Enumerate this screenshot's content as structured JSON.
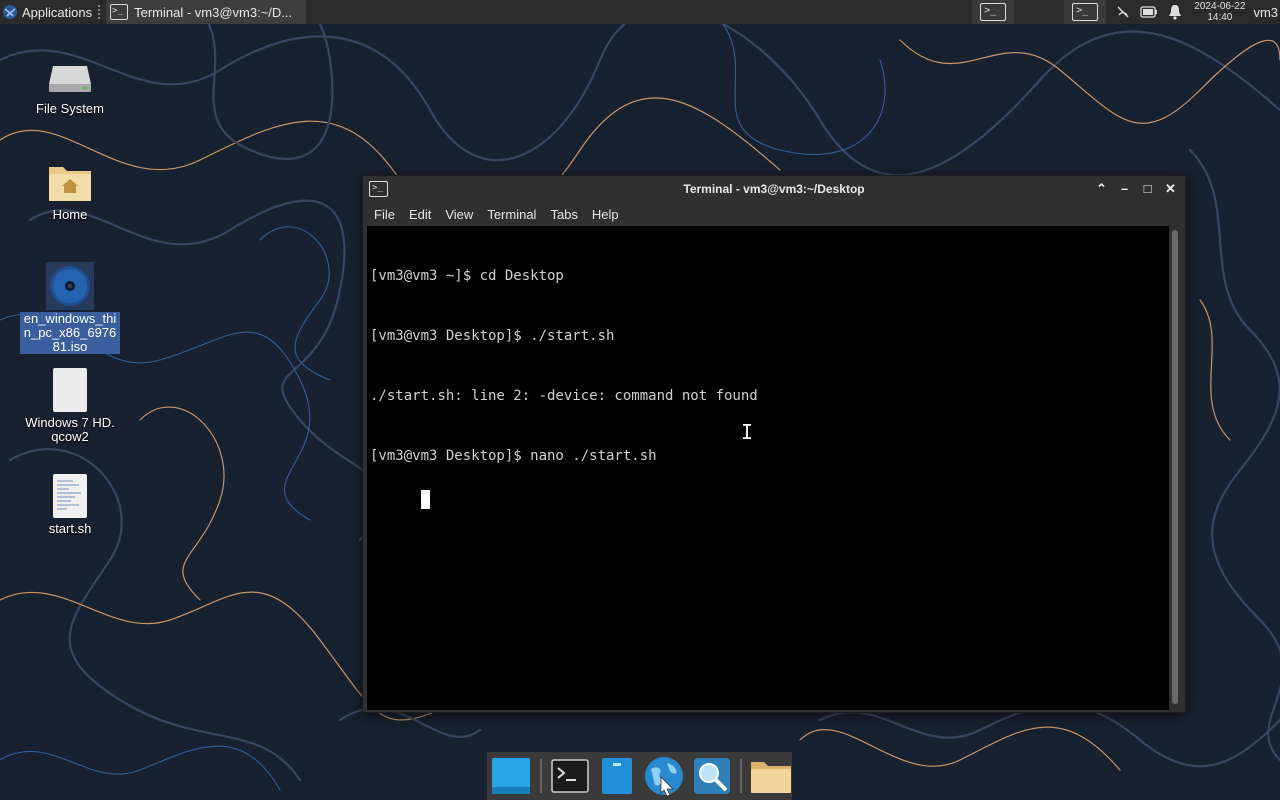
{
  "top_panel": {
    "applications_label": "Applications",
    "task_title": "Terminal - vm3@vm3:~/D...",
    "clock_date": "2024-06-22",
    "clock_time": "14:40",
    "user": "vm3"
  },
  "desktop_icons": [
    {
      "label": "File System",
      "icon": "drive-icon"
    },
    {
      "label": "Home",
      "icon": "home-folder-icon"
    },
    {
      "label": "en_windows_thin_pc_x86_697681.iso",
      "icon": "disc-image-icon"
    },
    {
      "label": "Windows 7 HD.qcow2",
      "icon": "file-icon"
    },
    {
      "label": "start.sh",
      "icon": "script-file-icon"
    }
  ],
  "terminal": {
    "title": "Terminal - vm3@vm3:~/Desktop",
    "menu": [
      "File",
      "Edit",
      "View",
      "Terminal",
      "Tabs",
      "Help"
    ],
    "lines": [
      "[vm3@vm3 ~]$ cd Desktop",
      "[vm3@vm3 Desktop]$ ./start.sh",
      "./start.sh: line 2: -device: command not found",
      "[vm3@vm3 Desktop]$ nano ./start.sh"
    ]
  },
  "dock": {
    "items": [
      "show-desktop-icon",
      "terminal-icon",
      "file-manager-icon",
      "web-browser-icon",
      "app-finder-icon",
      "folder-icon"
    ]
  },
  "colors": {
    "panel_bg": "#2b2b2b",
    "window_bg": "#303030",
    "terminal_bg": "#000000",
    "selection": "#3b5f9e"
  }
}
